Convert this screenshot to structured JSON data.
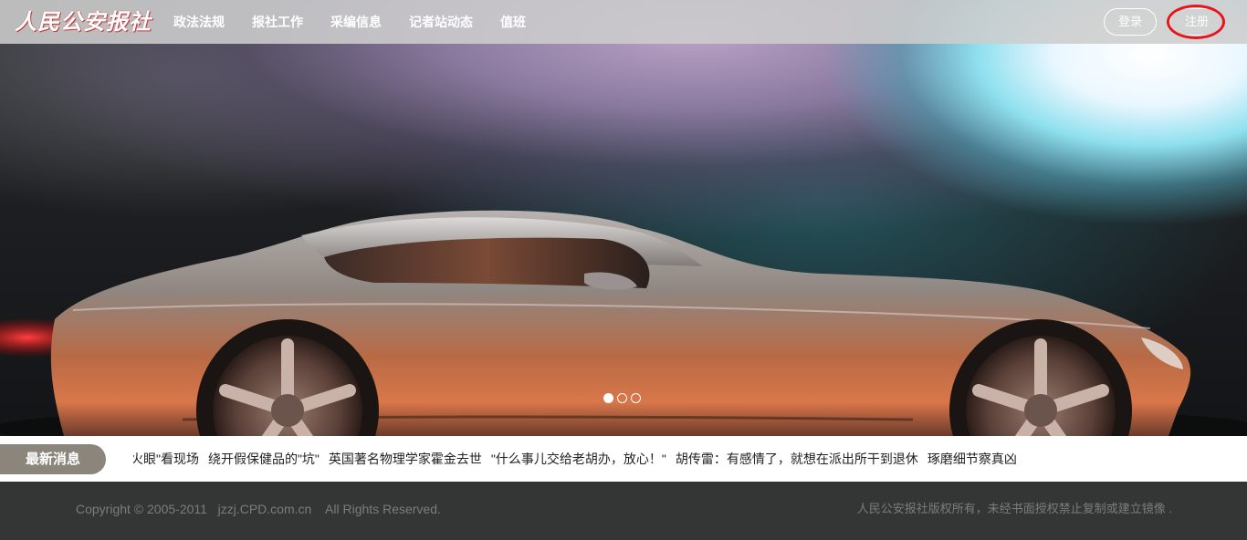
{
  "header": {
    "logo_text": "人民公安报社",
    "nav": [
      "政法法规",
      "报社工作",
      "采编信息",
      "记者站动态",
      "值班"
    ],
    "login_label": "登录",
    "register_label": "注册",
    "annotation_color": "#e8131b"
  },
  "carousel": {
    "slide_count": 3,
    "active_index": 0,
    "image_subject": "sports-car-illustration"
  },
  "news": {
    "label": "最新消息",
    "items": [
      "\"火眼\"看现场",
      "绕开假保健品的\"坑\"",
      "英国著名物理学家霍金去世",
      "\"什么事儿交给老胡办，放心！\"",
      "胡传雷：有感情了，就想在派出所干到退休",
      "琢磨细节察真凶"
    ]
  },
  "footer": {
    "copyright": "Copyright © 2005-2011   jzzj.CPD.com.cn    All Rights Reserved.",
    "rights": "人民公安报社版权所有，未经书面授权禁止复制或建立镜像 ."
  }
}
